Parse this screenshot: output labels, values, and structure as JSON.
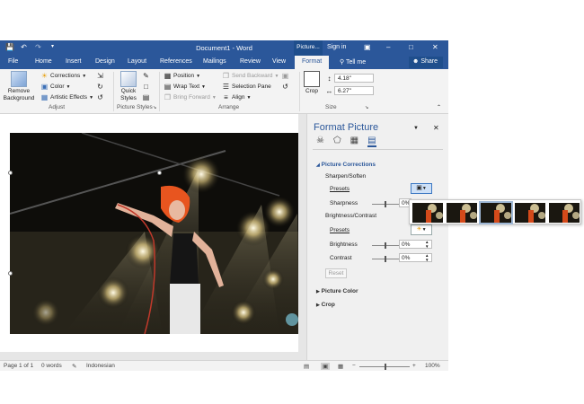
{
  "qat": {
    "save_icon": "save-icon",
    "undo_icon": "undo-icon",
    "redo_icon": "redo-icon",
    "customize_icon": "customize-icon"
  },
  "titlebar": {
    "doc_title": "Document1 - Word",
    "context_tab": "Picture...",
    "signin": "Sign in",
    "color": "#2b579a"
  },
  "tabs": [
    "File",
    "Home",
    "Insert",
    "Design",
    "Layout",
    "References",
    "Mailings",
    "Review",
    "View",
    "Format"
  ],
  "tell_me": "Tell me",
  "share": "Share",
  "ribbon": {
    "remove_background": "Remove Background",
    "corrections": "Corrections",
    "color": "Color",
    "artistic_effects": "Artistic Effects",
    "quick_styles": "Quick Styles",
    "position": "Position",
    "wrap_text": "Wrap Text",
    "bring_forward": "Bring Forward",
    "send_backward": "Send Backward",
    "selection_pane": "Selection Pane",
    "align": "Align",
    "crop": "Crop",
    "height_value": "4.18\"",
    "width_value": "6.27\"",
    "groups": {
      "adjust": "Adjust",
      "picture_styles": "Picture Styles",
      "arrange": "Arrange",
      "size": "Size"
    }
  },
  "pane": {
    "title": "Format Picture",
    "picture_corrections": "Picture Corrections",
    "sharpen_soften": "Sharpen/Soften",
    "presets": "Presets",
    "sharpness": "Sharpness",
    "sharpness_value": "0%",
    "brightness_contrast": "Brightness/Contrast",
    "presets2": "Presets",
    "brightness": "Brightness",
    "brightness_value": "0%",
    "contrast": "Contrast",
    "contrast_value": "0%",
    "reset": "Reset",
    "picture_color": "Picture Color",
    "crop": "Crop"
  },
  "statusbar": {
    "page": "Page 1 of 1",
    "words": "0 words",
    "language": "Indonesian",
    "zoom": "100%"
  },
  "gallery": {
    "count": 5,
    "selected_index": 2
  }
}
